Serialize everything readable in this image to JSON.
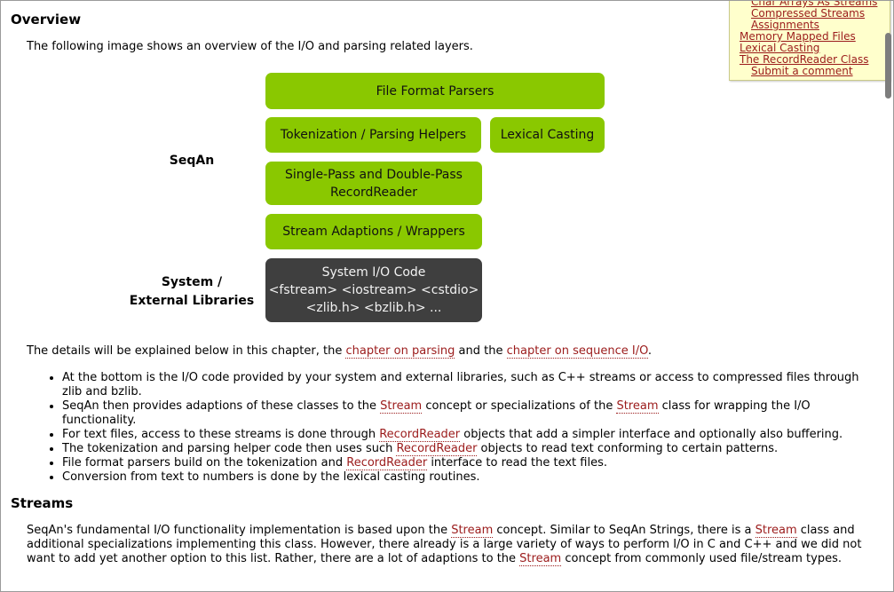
{
  "overview": {
    "heading": "Overview",
    "intro": "The following image shows an overview of the I/O and parsing related layers."
  },
  "diagram": {
    "label_seqan": "SeqAn",
    "label_system_1": "System /",
    "label_system_2": "External Libraries",
    "box_file_format": "File Format Parsers",
    "box_tokenization": "Tokenization / Parsing Helpers",
    "box_lexical": "Lexical Casting",
    "box_recordreader_1": "Single-Pass and Double-Pass",
    "box_recordreader_2": "RecordReader",
    "box_stream_adaptions": "Stream Adaptions / Wrappers",
    "box_system_1": "System I/O Code",
    "box_system_2": "<fstream> <iostream> <cstdio>",
    "box_system_3": "<zlib.h> <bzlib.h> ..."
  },
  "details": {
    "before": "The details will be explained below in this chapter, the ",
    "link1": "chapter on parsing",
    "middle": " and the ",
    "link2": "chapter on sequence I/O",
    "after": "."
  },
  "bullets": {
    "b1": "At the bottom is the I/O code provided by your system and external libraries, such as C++ streams or access to compressed files through zlib and bzlib.",
    "b2_a": "SeqAn then provides adaptions of these classes to the ",
    "b2_link1": "Stream",
    "b2_b": " concept or specializations of the ",
    "b2_link2": "Stream",
    "b2_c": " class for wrapping the I/O functionality.",
    "b3_a": "For text files, access to these streams is done through ",
    "b3_link": "RecordReader",
    "b3_b": " objects that add a simpler interface and optionally also buffering.",
    "b4_a": "The tokenization and parsing helper code then uses such ",
    "b4_link": "RecordReader",
    "b4_b": " objects to read text conforming to certain patterns.",
    "b5_a": "File format parsers build on the tokenization and ",
    "b5_link": "RecordReader",
    "b5_b": " interface to read the text files.",
    "b6": "Conversion from text to numbers is done by the lexical casting routines."
  },
  "streams": {
    "heading": "Streams",
    "p_a": "SeqAn's fundamental I/O functionality implementation is based upon the ",
    "p_link1": "Stream",
    "p_b": " concept. Similar to SeqAn Strings, there is a ",
    "p_link2": "Stream",
    "p_c": " class and additional specializations implementing this class. However, there already is a large variety of ways to perform I/O in C and C++ and we did not want to add yet another option to this list. Rather, there are a lot of adaptions to the ",
    "p_link3": "Stream",
    "p_d": " concept from commonly used file/stream types."
  },
  "toc": {
    "items": [
      "Char Arrays As Streams",
      "Compressed Streams",
      "Assignments",
      "Memory Mapped Files",
      "Lexical Casting",
      "The RecordReader Class",
      "Submit a comment"
    ]
  },
  "colors": {
    "box_green": "#8ac800",
    "box_dark": "#3f3f3f",
    "link": "#9b1b1b",
    "toc_bg": "#ffffcc"
  }
}
